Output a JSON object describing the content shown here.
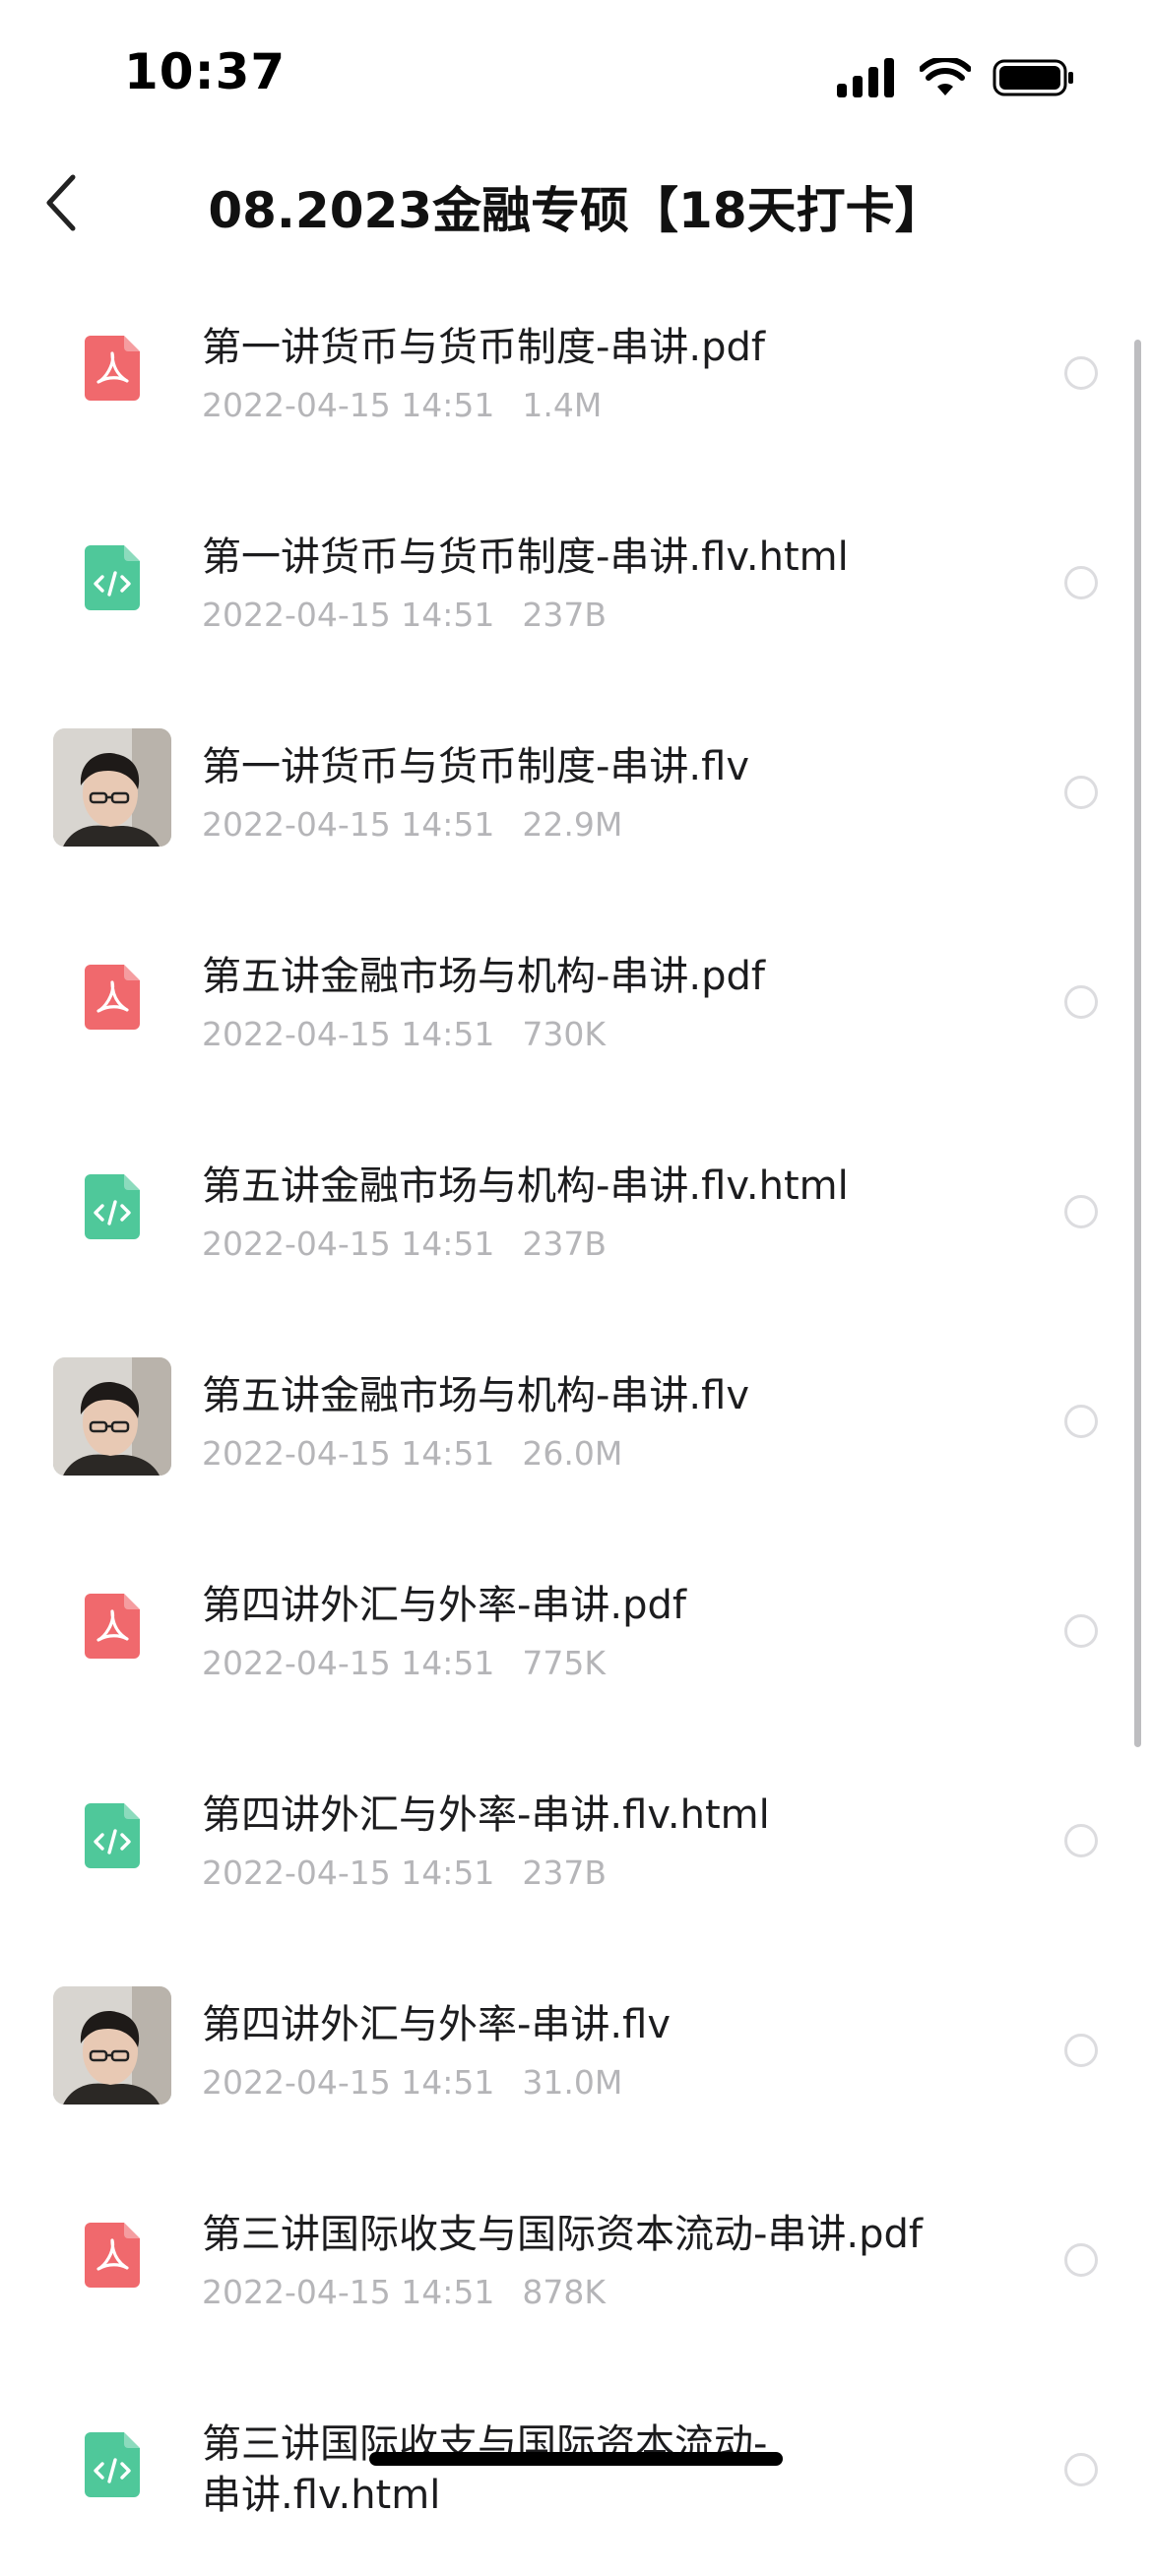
{
  "status_bar": {
    "time": "10:37"
  },
  "header": {
    "title": "08.2023金融专硕【18天打卡】"
  },
  "files": [
    {
      "type": "pdf",
      "name": "第一讲货币与货币制度-串讲.pdf",
      "date": "2022-04-15 14:51",
      "size": "1.4M"
    },
    {
      "type": "html",
      "name": "第一讲货币与货币制度-串讲.flv.html",
      "date": "2022-04-15 14:51",
      "size": "237B"
    },
    {
      "type": "video",
      "name": "第一讲货币与货币制度-串讲.flv",
      "date": "2022-04-15 14:51",
      "size": "22.9M"
    },
    {
      "type": "pdf",
      "name": "第五讲金融市场与机构-串讲.pdf",
      "date": "2022-04-15 14:51",
      "size": "730K"
    },
    {
      "type": "html",
      "name": "第五讲金融市场与机构-串讲.flv.html",
      "date": "2022-04-15 14:51",
      "size": "237B"
    },
    {
      "type": "video",
      "name": "第五讲金融市场与机构-串讲.flv",
      "date": "2022-04-15 14:51",
      "size": "26.0M"
    },
    {
      "type": "pdf",
      "name": "第四讲外汇与外率-串讲.pdf",
      "date": "2022-04-15 14:51",
      "size": "775K"
    },
    {
      "type": "html",
      "name": "第四讲外汇与外率-串讲.flv.html",
      "date": "2022-04-15 14:51",
      "size": "237B"
    },
    {
      "type": "video",
      "name": "第四讲外汇与外率-串讲.flv",
      "date": "2022-04-15 14:51",
      "size": "31.0M"
    },
    {
      "type": "pdf",
      "name": "第三讲国际收支与国际资本流动-串讲.pdf",
      "date": "2022-04-15 14:51",
      "size": "878K"
    },
    {
      "type": "html",
      "name": "第三讲国际收支与国际资本流动-",
      "name_line2": "串讲.flv.html",
      "date": "",
      "size": ""
    }
  ],
  "colors": {
    "pdf_icon": "#f0696d",
    "html_icon": "#4fc89a",
    "meta_text": "#b5b5b8",
    "radio_border": "#dcdcdf"
  },
  "icons": {
    "back": "chevron-left-icon",
    "pdf": "pdf-file-icon",
    "html": "code-file-icon",
    "radio": "radio-circle-icon"
  }
}
